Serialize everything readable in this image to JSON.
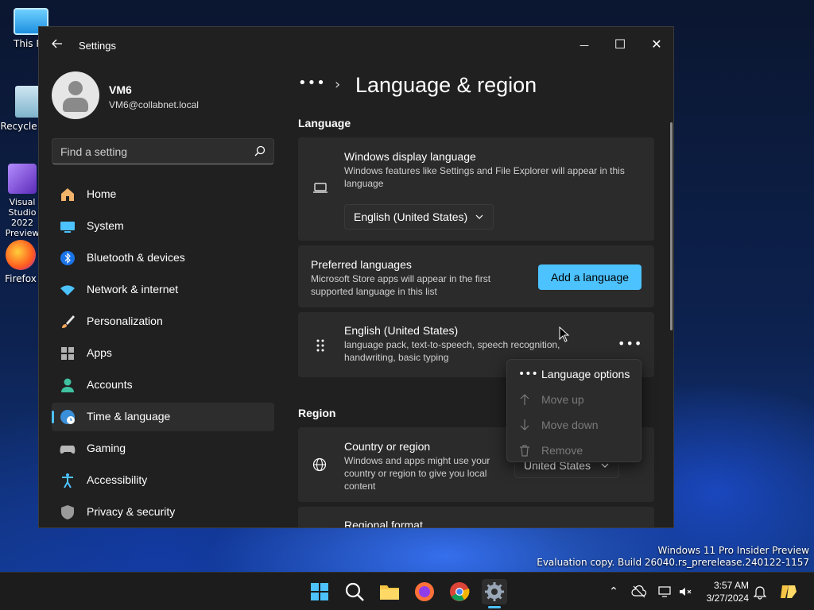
{
  "desktop": {
    "icons": [
      {
        "label": "This PC"
      },
      {
        "label": "Recycle Bin"
      },
      {
        "label": "Visual Studio 2022 Preview"
      },
      {
        "label": "Firefox"
      }
    ],
    "watermark": {
      "line1": "Windows 11 Pro Insider Preview",
      "line2": "Evaluation copy. Build 26040.rs_prerelease.240122-1157"
    }
  },
  "window": {
    "title": "Settings",
    "controls": {
      "minimize": "—",
      "maximize": "☐",
      "close": "✕"
    }
  },
  "profile": {
    "name": "VM6",
    "email": "VM6@collabnet.local"
  },
  "search": {
    "placeholder": "Find a setting"
  },
  "nav": [
    {
      "label": "Home",
      "icon": "home-icon"
    },
    {
      "label": "System",
      "icon": "system-icon"
    },
    {
      "label": "Bluetooth & devices",
      "icon": "bluetooth-icon"
    },
    {
      "label": "Network & internet",
      "icon": "wifi-icon"
    },
    {
      "label": "Personalization",
      "icon": "brush-icon"
    },
    {
      "label": "Apps",
      "icon": "apps-icon"
    },
    {
      "label": "Accounts",
      "icon": "accounts-icon"
    },
    {
      "label": "Time & language",
      "icon": "globe-clock-icon",
      "active": true
    },
    {
      "label": "Gaming",
      "icon": "gamepad-icon"
    },
    {
      "label": "Accessibility",
      "icon": "accessibility-icon"
    },
    {
      "label": "Privacy & security",
      "icon": "shield-icon"
    }
  ],
  "breadcrumb": {
    "more": "•••",
    "separator": "›",
    "title": "Language & region"
  },
  "language": {
    "section_title": "Language",
    "display_language": {
      "title": "Windows display language",
      "desc": "Windows features like Settings and File Explorer will appear in this language",
      "value": "English (United States)"
    },
    "preferred": {
      "title": "Preferred languages",
      "desc": "Microsoft Store apps will appear in the first supported language in this list",
      "button": "Add a language"
    },
    "entry": {
      "title": "English (United States)",
      "desc": "language pack, text-to-speech, speech recognition, handwriting, basic typing",
      "more": "•••"
    }
  },
  "context_menu": {
    "items": [
      {
        "label": "Language options",
        "icon": "more-icon",
        "enabled": true
      },
      {
        "label": "Move up",
        "icon": "arrow-up-icon",
        "enabled": false
      },
      {
        "label": "Move down",
        "icon": "arrow-down-icon",
        "enabled": false
      },
      {
        "label": "Remove",
        "icon": "trash-icon",
        "enabled": false
      }
    ]
  },
  "region": {
    "section_title": "Region",
    "country": {
      "title": "Country or region",
      "desc": "Windows and apps might use your country or region to give you local content",
      "value": "United States"
    },
    "format": {
      "title": "Regional format"
    }
  },
  "taskbar": {
    "time": "3:57 AM",
    "date": "3/27/2024"
  },
  "colors": {
    "accent": "#4cc2ff",
    "window_bg": "#202020",
    "card_bg": "#2b2b2b"
  }
}
